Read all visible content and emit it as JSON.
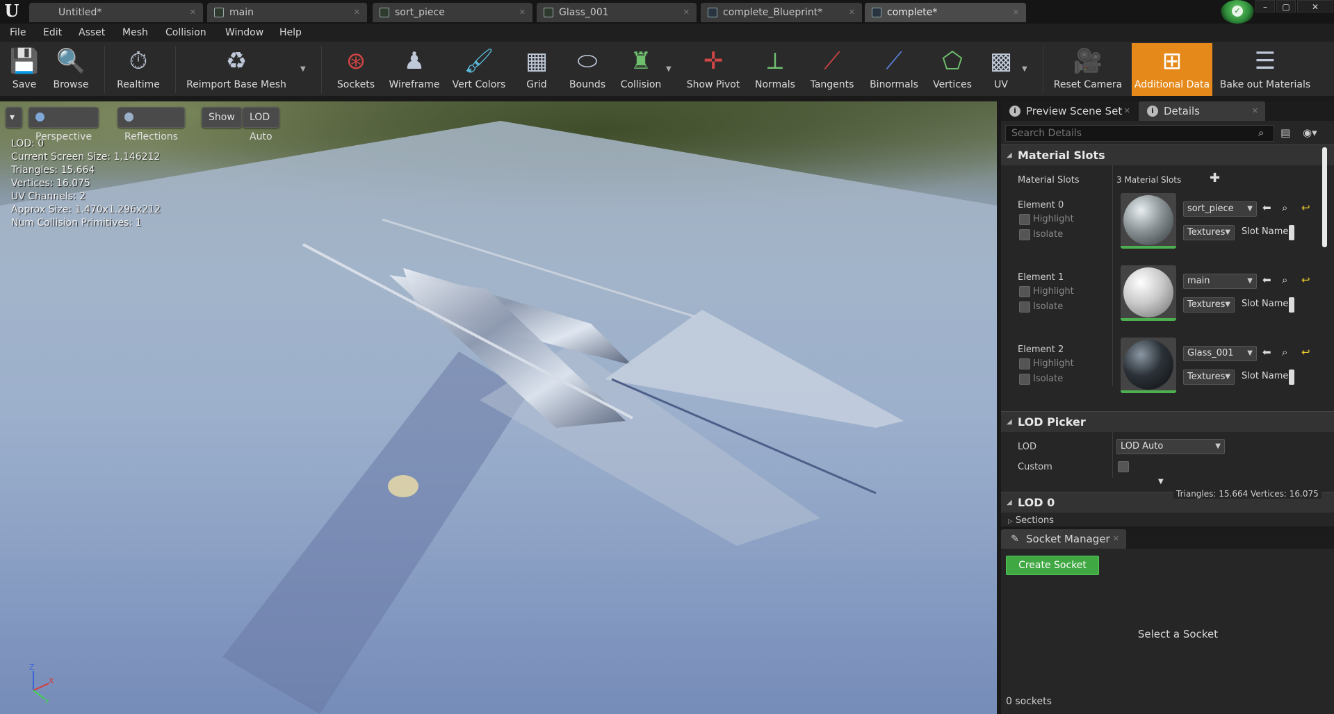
{
  "app": {
    "logo": "U"
  },
  "tabs": [
    {
      "label": "Untitled*"
    },
    {
      "label": "main"
    },
    {
      "label": "sort_piece"
    },
    {
      "label": "Glass_001"
    },
    {
      "label": "complete_Blueprint*"
    },
    {
      "label": "complete*"
    }
  ],
  "window_controls": {
    "minimize": "–",
    "restore": "▢",
    "close": "✕"
  },
  "menu": [
    "File",
    "Edit",
    "Asset",
    "Mesh",
    "Collision",
    "Window",
    "Help"
  ],
  "toolbar": {
    "save": "Save",
    "browse": "Browse",
    "realtime": "Realtime",
    "reimport": "Reimport Base Mesh",
    "sockets": "Sockets",
    "wireframe": "Wireframe",
    "vert_colors": "Vert Colors",
    "grid": "Grid",
    "bounds": "Bounds",
    "collision": "Collision",
    "show_pivot": "Show Pivot",
    "normals": "Normals",
    "tangents": "Tangents",
    "binormals": "Binormals",
    "vertices": "Vertices",
    "uv": "UV",
    "reset_camera": "Reset Camera",
    "additional_data": "Additional Data",
    "bake_out": "Bake out Materials"
  },
  "viewport": {
    "perspective": "Perspective",
    "reflections": "Reflections",
    "show": "Show",
    "lod": "LOD Auto",
    "stats": {
      "lod": "LOD:  0",
      "screen_size": "Current Screen Size:  1,146212",
      "triangles": "Triangles:  15.664",
      "vertices": "Vertices:  16.075",
      "uv_channels": "UV Channels:  2",
      "approx_size": "Approx Size: 1.470x1.296x212",
      "num_collision": "Num Collision Primitives:  1"
    },
    "axis": {
      "z": "Z",
      "x": "X",
      "y": "Y"
    }
  },
  "details": {
    "tab_preview": "Preview Scene Set",
    "tab_details": "Details",
    "search_placeholder": "Search Details",
    "material_slots_header": "Material Slots",
    "material_slots_label": "Material Slots",
    "material_slots_value": "3 Material Slots",
    "elements": [
      {
        "label": "Element 0",
        "material": "sort_piece",
        "highlight": "Highlight",
        "isolate": "Isolate",
        "textures": "Textures",
        "slot_name": "Slot Name",
        "sphere": "#8a9296"
      },
      {
        "label": "Element 1",
        "material": "main",
        "highlight": "Highlight",
        "isolate": "Isolate",
        "textures": "Textures",
        "slot_name": "Slot Name",
        "sphere": "#c9c9c9"
      },
      {
        "label": "Element 2",
        "material": "Glass_001",
        "highlight": "Highlight",
        "isolate": "Isolate",
        "textures": "Textures",
        "slot_name": "Slot Name",
        "sphere": "#2b3137"
      }
    ],
    "lod_picker_header": "LOD Picker",
    "lod_label": "LOD",
    "lod_value": "LOD Auto",
    "custom_label": "Custom",
    "lod0_header": "LOD 0",
    "lod0_stats": "Triangles: 15.664   Vertices: 16.075",
    "sections_label": "Sections"
  },
  "socket_manager": {
    "tab": "Socket Manager",
    "create": "Create Socket",
    "select": "Select a Socket",
    "count": "0 sockets"
  },
  "colors": {
    "accent_active": "#e5891a",
    "create_green": "#3fa842"
  }
}
